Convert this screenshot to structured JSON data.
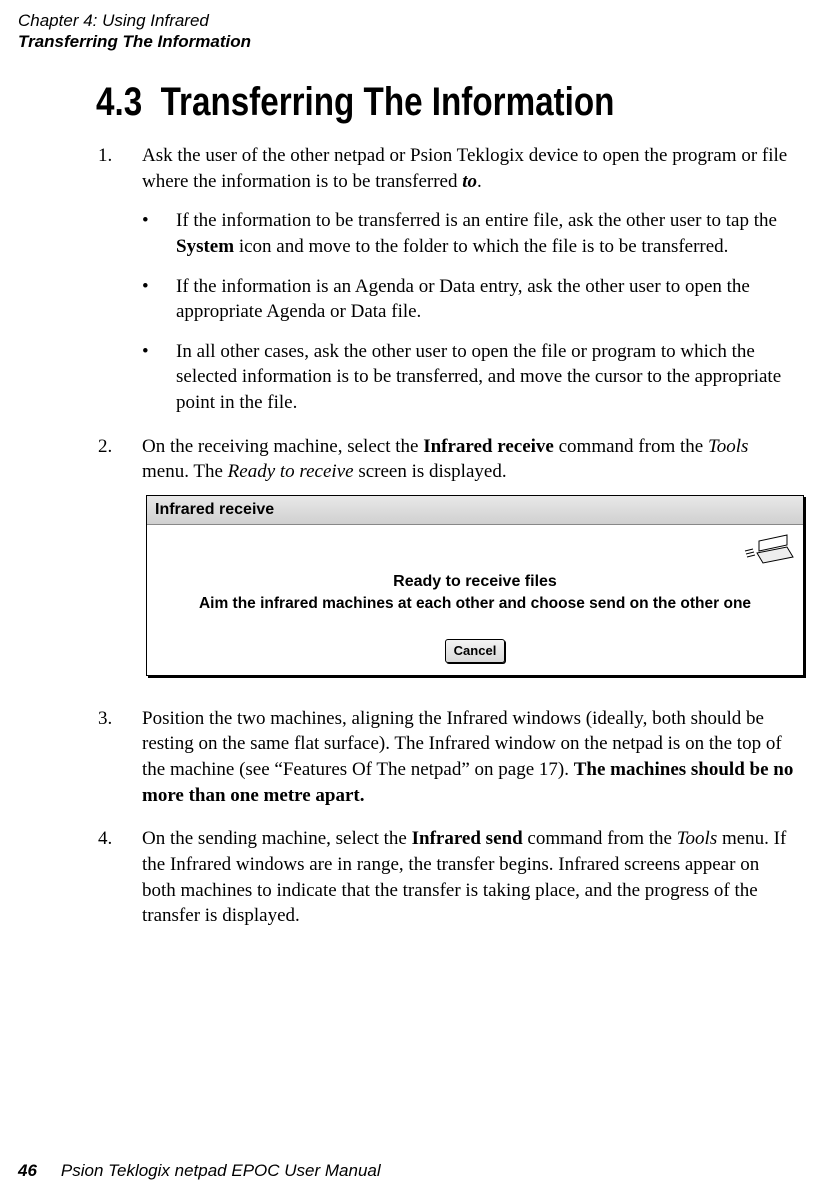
{
  "header": {
    "chapter": "Chapter 4:  Using Infrared",
    "section": "Transferring The Information"
  },
  "heading": {
    "number": "4.3",
    "title": "Transferring The Information"
  },
  "steps": {
    "s1": {
      "num": "1.",
      "text_a": "Ask the user of the other netpad or Psion Teklogix device to open the program or file where the information is to be transferred ",
      "to": "to",
      "period": "."
    },
    "bullets": {
      "b1_a": "If the information to be transferred is an entire file, ask the other user to tap the ",
      "b1_bold": "System",
      "b1_c": " icon and move to the folder to which the file is to be transferred.",
      "b2": "If the information is an Agenda or Data entry, ask the other user to open the appropriate Agenda or Data file.",
      "b3": "In all other cases, ask the other user to open the file or program to which the selected information is to be transferred, and move the cursor to the appropriate point in the file."
    },
    "s2": {
      "num": "2.",
      "a": "On the receiving machine, select the ",
      "bold": "Infrared receive",
      "b": " command from the ",
      "it1": "Tools",
      "c": " menu. The ",
      "it2": "Ready to receive",
      "d": " screen is displayed."
    },
    "s3": {
      "num": "3.",
      "a": "Position the two machines, aligning the Infrared windows (ideally, both should be resting on the same flat surface). The Infrared window on the netpad is on the top of the machine (see “Features Of The netpad” on page 17). ",
      "bold": "The machines should be no more than one metre apart."
    },
    "s4": {
      "num": "4.",
      "a": "On the sending machine, select the ",
      "bold": "Infrared send",
      "b": " command from the ",
      "it": "Tools",
      "c": " menu. If the Infrared windows are in range, the transfer begins. Infrared screens appear on both machines to indicate that the transfer is taking place, and the progress of the transfer is displayed."
    }
  },
  "dialog": {
    "title": "Infrared receive",
    "line1": "Ready to receive files",
    "line2": "Aim the infrared machines at each other and choose send on the other one",
    "button": "Cancel"
  },
  "footer": {
    "page": "46",
    "text": "Psion Teklogix netpad EPOC User Manual"
  }
}
